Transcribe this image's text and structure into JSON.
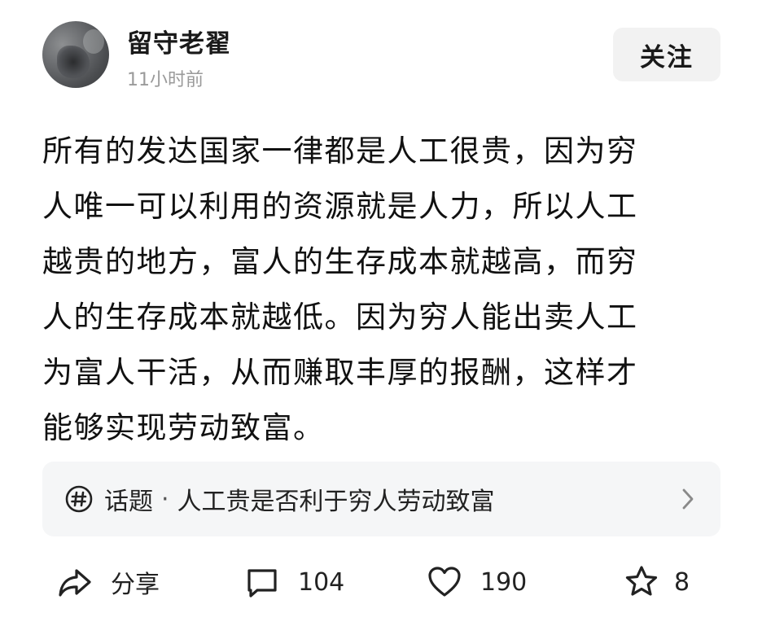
{
  "author": {
    "name": "留守老翟",
    "time": "11小时前",
    "follow_label": "关注"
  },
  "post": {
    "lines": [
      "所有的发达国家一律都是人工很贵，因为穷",
      "人唯一可以利用的资源就是人力，所以人工",
      "越贵的地方，富人的生存成本就越高，而穷",
      "人的生存成本就越低。因为穷人能出卖人工",
      "为富人干活，从而赚取丰厚的报酬，这样才",
      "能够实现劳动致富。"
    ]
  },
  "topic": {
    "icon": "hashtag-icon",
    "label": "话题",
    "separator": "·",
    "title": "人工贵是否利于穷人劳动致富"
  },
  "actions": {
    "share": {
      "icon": "share-icon",
      "label": "分享"
    },
    "comment": {
      "icon": "comment-icon",
      "count": "104"
    },
    "like": {
      "icon": "heart-icon",
      "count": "190"
    },
    "favorite": {
      "icon": "star-icon",
      "count": "8"
    }
  }
}
